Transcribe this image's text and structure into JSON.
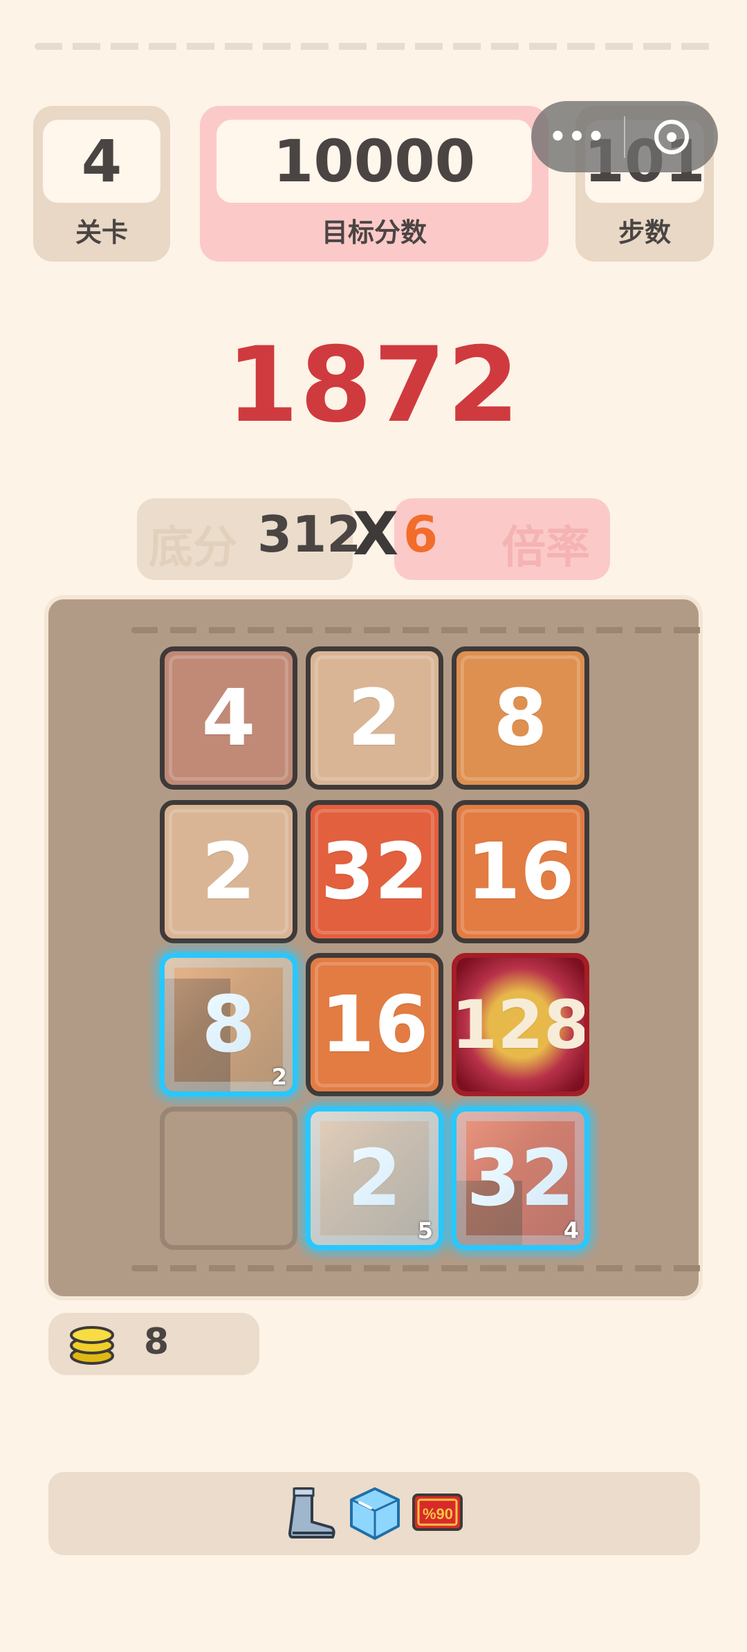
{
  "header": {
    "level": {
      "value": "4",
      "label": "关卡"
    },
    "target": {
      "value": "10000",
      "label": "目标分数"
    },
    "steps": {
      "value": "101",
      "label": "步数"
    }
  },
  "capsule": {
    "more": "•••"
  },
  "score": "1872",
  "formula": {
    "base_label": "底分",
    "base_value": "312",
    "times": "X",
    "multiplier_value": "6",
    "multiplier_label": "倍率"
  },
  "board": {
    "rows": [
      [
        {
          "value": "4"
        },
        {
          "value": "2"
        },
        {
          "value": "8"
        }
      ],
      [
        {
          "value": "2"
        },
        {
          "value": "32"
        },
        {
          "value": "16"
        }
      ],
      [
        {
          "value": "8",
          "ice": "2"
        },
        {
          "value": "16"
        },
        {
          "value": "128",
          "monster": true
        }
      ],
      [
        {
          "value": ""
        },
        {
          "value": "2",
          "ice": "5"
        },
        {
          "value": "32",
          "ice": "4"
        }
      ]
    ]
  },
  "coins": {
    "value": "8"
  },
  "items": [
    "boot-icon",
    "ice-cube-icon",
    "card-icon"
  ],
  "colors": {
    "background": "#fdf3e6",
    "score": "#cf3a3f",
    "multiplier": "#f26d2b",
    "board": "#b29b86",
    "ice_border": "#27c8ff"
  }
}
